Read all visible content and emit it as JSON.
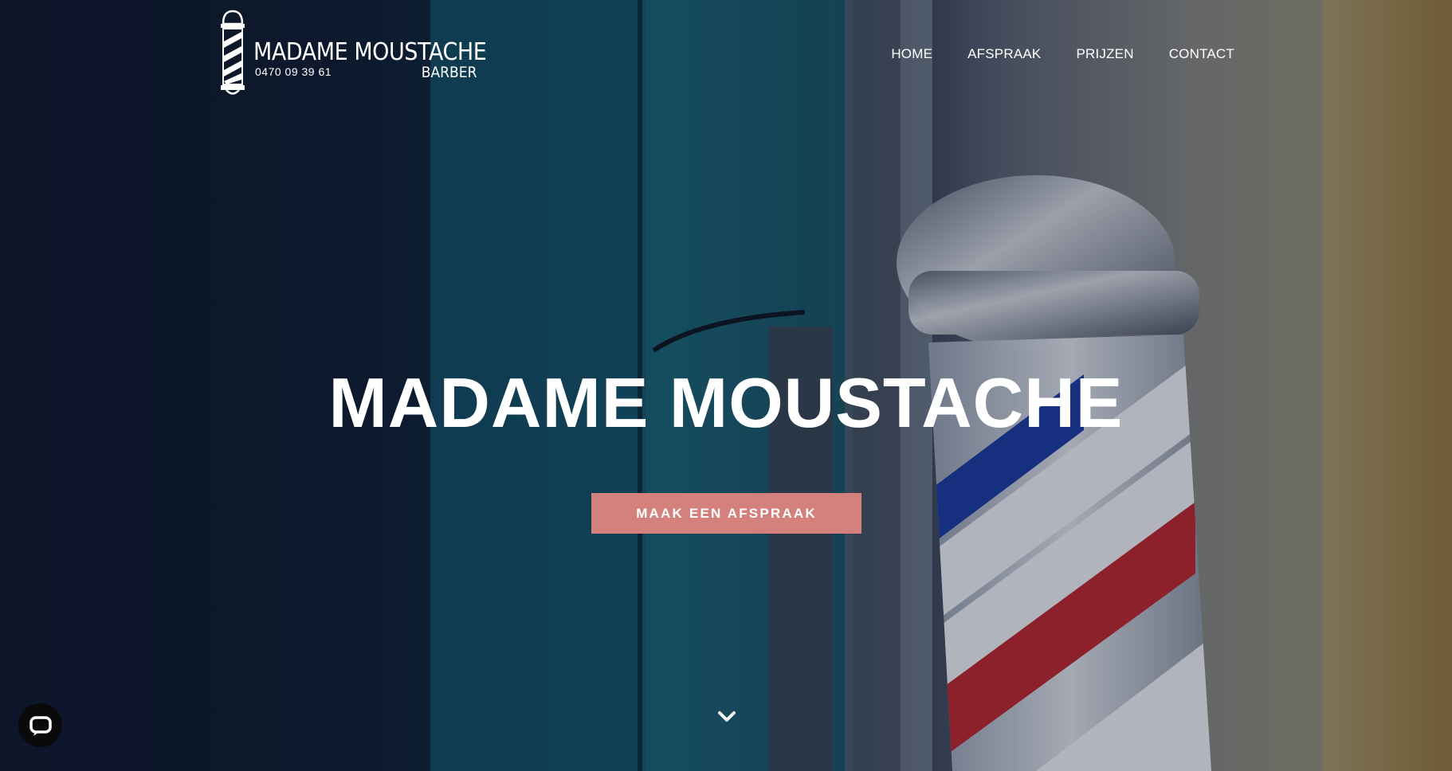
{
  "header": {
    "logo": {
      "name": "MADAME MOUSTACHE",
      "phone": "0470 09 39 61",
      "subtitle": "BARBER"
    },
    "nav": [
      {
        "label": "HOME"
      },
      {
        "label": "AFSPRAAK"
      },
      {
        "label": "PRIJZEN"
      },
      {
        "label": "CONTACT"
      }
    ]
  },
  "hero": {
    "title": "MADAME MOUSTACHE",
    "cta_label": "MAAK EEN AFSPRAAK"
  },
  "icons": {
    "logo": "barber-pole-icon",
    "scroll": "chevron-down-icon",
    "chat": "chat-icon"
  },
  "colors": {
    "accent": "#d4807c",
    "overlay": "#0e162a",
    "text": "#ffffff",
    "chat_button": "#0a0a0c"
  }
}
